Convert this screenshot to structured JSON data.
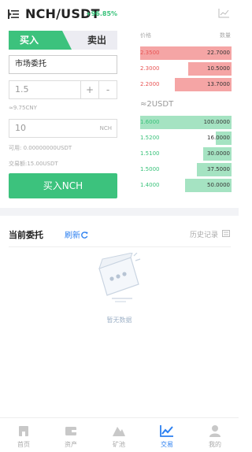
{
  "header": {
    "pair": "NCH/USDT",
    "change": "+96.85%",
    "menu_icon": "menu-icon",
    "chart_icon": "line-chart-icon"
  },
  "toggle": {
    "buy": "买入",
    "sell": "卖出"
  },
  "form": {
    "order_type": "市场委托",
    "price": "1.5",
    "plus": "+",
    "minus": "-",
    "cny_note": "≈9.75CNY",
    "amount": "10",
    "amount_unit": "NCH",
    "available": "可用: 0.00000000USDT",
    "volume": "交易额:15.00USDT",
    "submit": "买入NCH"
  },
  "orderbook": {
    "head_price": "价格",
    "head_qty": "数量",
    "mid": "≈2USDT",
    "asks": [
      {
        "price": "2.3500",
        "qty": "22.7000",
        "depth": 1.0
      },
      {
        "price": "2.3000",
        "qty": "10.5000",
        "depth": 0.47
      },
      {
        "price": "2.2000",
        "qty": "13.7000",
        "depth": 0.62
      }
    ],
    "bids": [
      {
        "price": "1.6000",
        "qty": "100.0000",
        "depth": 1.0
      },
      {
        "price": "1.5200",
        "qty": "16.0000",
        "depth": 0.17
      },
      {
        "price": "1.5100",
        "qty": "30.0000",
        "depth": 0.31
      },
      {
        "price": "1.5000",
        "qty": "37.5000",
        "depth": 0.38
      },
      {
        "price": "1.4000",
        "qty": "50.0000",
        "depth": 0.51
      }
    ],
    "colors": {
      "ask": "#e85454",
      "bid": "#39c27a"
    }
  },
  "orders": {
    "title": "当前委托",
    "refresh": "刷新",
    "refresh_icon": "refresh-icon",
    "history": "历史记录",
    "empty": "暂无数据"
  },
  "nav": {
    "items": [
      {
        "label": "首页",
        "icon": "home-icon",
        "active": false
      },
      {
        "label": "资产",
        "icon": "wallet-icon",
        "active": false
      },
      {
        "label": "矿池",
        "icon": "mountain-icon",
        "active": false
      },
      {
        "label": "交易",
        "icon": "trade-chart-icon",
        "active": true
      },
      {
        "label": "我的",
        "icon": "user-icon",
        "active": false
      }
    ]
  },
  "accent": "#3cc27d",
  "link_color": "#2b7ff0"
}
